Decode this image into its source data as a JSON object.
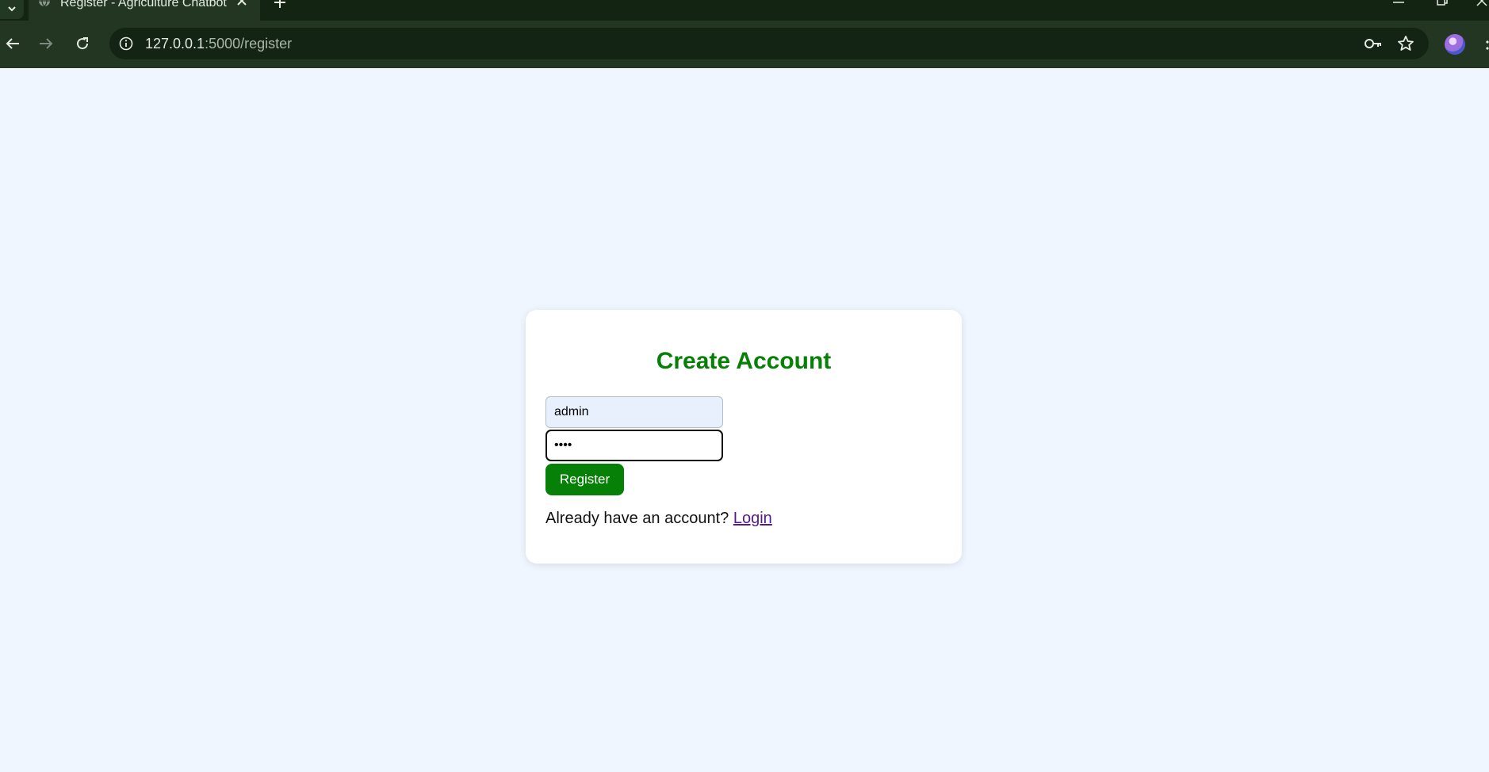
{
  "browser": {
    "tab_title": "Register - Agriculture Chatbot",
    "url_host": "127.0.0.1",
    "url_path": ":5000/register"
  },
  "page": {
    "heading": "Create Account",
    "username_value": "admin",
    "password_value": "••••",
    "register_label": "Register",
    "login_prompt": "Already have an account?",
    "login_link": "Login"
  },
  "colors": {
    "accent": "#078007",
    "page_background": "#eff6ff",
    "link": "#551a8b"
  }
}
